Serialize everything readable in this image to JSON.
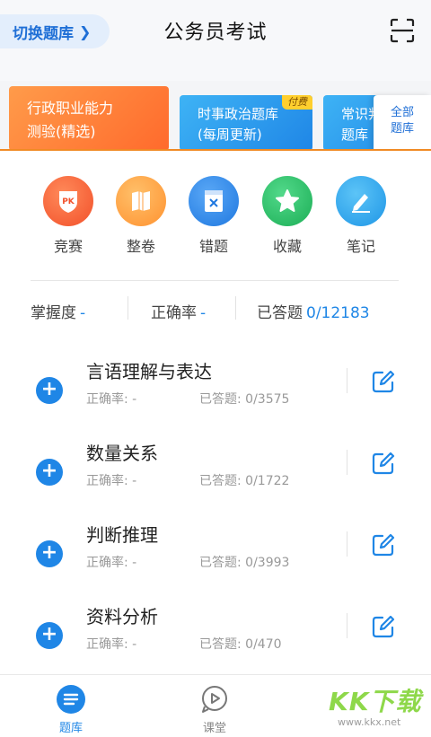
{
  "header": {
    "switch_label": "切换题库",
    "title": "公务员考试"
  },
  "banks": [
    {
      "line1": "行政职业能力",
      "line2": "测验(精选)"
    },
    {
      "line1": "时事政治题库",
      "line2": "(每周更新)",
      "badge": "付费"
    },
    {
      "line1": "常识判",
      "line2": "题库"
    }
  ],
  "all_banks": {
    "line1": "全部",
    "line2": "题库"
  },
  "quick_actions": [
    {
      "label": "竞赛",
      "icon": "pk-icon",
      "color": "#ff6a3a"
    },
    {
      "label": "整卷",
      "icon": "book-icon",
      "color": "#ffa244"
    },
    {
      "label": "错题",
      "icon": "wrong-icon",
      "color": "#2f8cf0"
    },
    {
      "label": "收藏",
      "icon": "star-icon",
      "color": "#2cc36a"
    },
    {
      "label": "笔记",
      "icon": "pen-icon",
      "color": "#2fa8f0"
    }
  ],
  "stats": {
    "mastery_label": "掌握度",
    "mastery_value": "-",
    "accuracy_label": "正确率",
    "accuracy_value": "-",
    "answered_label": "已答题",
    "answered_value": "0/12183"
  },
  "categories": [
    {
      "name": "言语理解与表达",
      "accuracy": "正确率: -",
      "answered": "已答题: 0/3575"
    },
    {
      "name": "数量关系",
      "accuracy": "正确率: -",
      "answered": "已答题: 0/1722"
    },
    {
      "name": "判断推理",
      "accuracy": "正确率: -",
      "answered": "已答题: 0/3993"
    },
    {
      "name": "资料分析",
      "accuracy": "正确率: -",
      "answered": "已答题: 0/470"
    }
  ],
  "bottom_nav": [
    {
      "label": "题库",
      "active": true
    },
    {
      "label": "课堂",
      "active": false
    }
  ],
  "watermark": {
    "text": "KK下载",
    "sub": "www.kkx.net"
  },
  "colors": {
    "accent": "#1f86e6",
    "orange": "#ff6a2c",
    "watermark": "#8ed84a"
  }
}
